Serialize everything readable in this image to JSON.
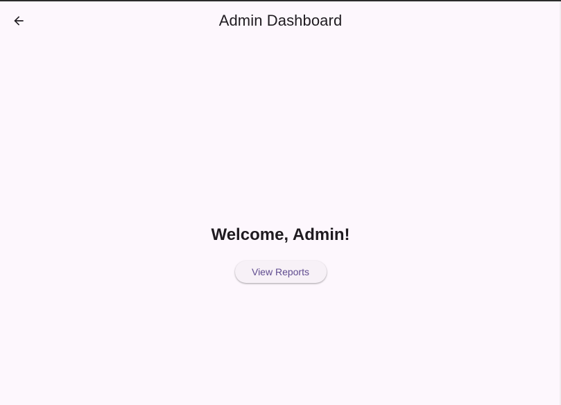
{
  "app_bar": {
    "back_icon": "arrow-left-icon",
    "title": "Admin Dashboard"
  },
  "main": {
    "welcome_text": "Welcome, Admin!",
    "view_reports_label": "View Reports"
  },
  "colors": {
    "background": "#fdf7fd",
    "text_primary": "#1f1b20",
    "button_text": "#5f4b8f",
    "button_background": "#f7f1f7"
  }
}
